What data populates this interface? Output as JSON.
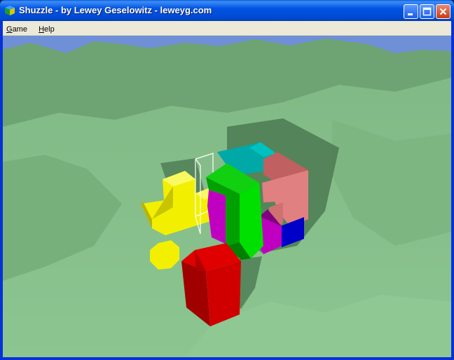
{
  "window": {
    "title": "Shuzzle - by Lewey Geselowitz - leweyg.com",
    "icon": "shuzzle-cube-icon"
  },
  "controls": {
    "minimize_icon": "minimize-icon",
    "maximize_icon": "maximize-icon",
    "close_icon": "close-icon"
  },
  "menu": {
    "items": [
      {
        "label": "Game",
        "mnemonic": "G",
        "rest": "ame"
      },
      {
        "label": "Help",
        "mnemonic": "H",
        "rest": "elp"
      }
    ]
  },
  "scene": {
    "sky_color": "#6f8fd6",
    "terrain_color": "#86bf8a",
    "pieces": [
      {
        "name": "yellow-L-piece",
        "color": "#f2f000"
      },
      {
        "name": "yellow-sphere",
        "color": "#f2f000"
      },
      {
        "name": "red-piece",
        "color": "#e00000"
      },
      {
        "name": "green-piece",
        "color": "#00e000"
      },
      {
        "name": "magenta-piece",
        "color": "#c800c8"
      },
      {
        "name": "cyan-piece",
        "color": "#00a0a0"
      },
      {
        "name": "salmon-piece",
        "color": "#e08080"
      },
      {
        "name": "blue-piece",
        "color": "#0000c8"
      }
    ]
  }
}
